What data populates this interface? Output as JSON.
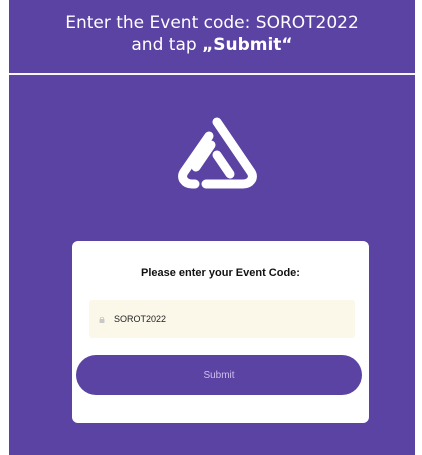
{
  "header": {
    "line1": "Enter the Event code: SOROT2022",
    "line2_prefix": "and tap ",
    "line2_emphasis": "„Submit“"
  },
  "logo": {
    "icon": "triangular-loop-logo-icon"
  },
  "form": {
    "title": "Please enter your Event Code:",
    "event_code_value": "SOROT2022",
    "field_icon": "lock-icon",
    "submit_label": "Submit"
  },
  "colors": {
    "brand_purple": "#5b43a4",
    "card_white": "#ffffff",
    "field_background": "#fbf8ea",
    "button_text": "#cdbff0"
  }
}
